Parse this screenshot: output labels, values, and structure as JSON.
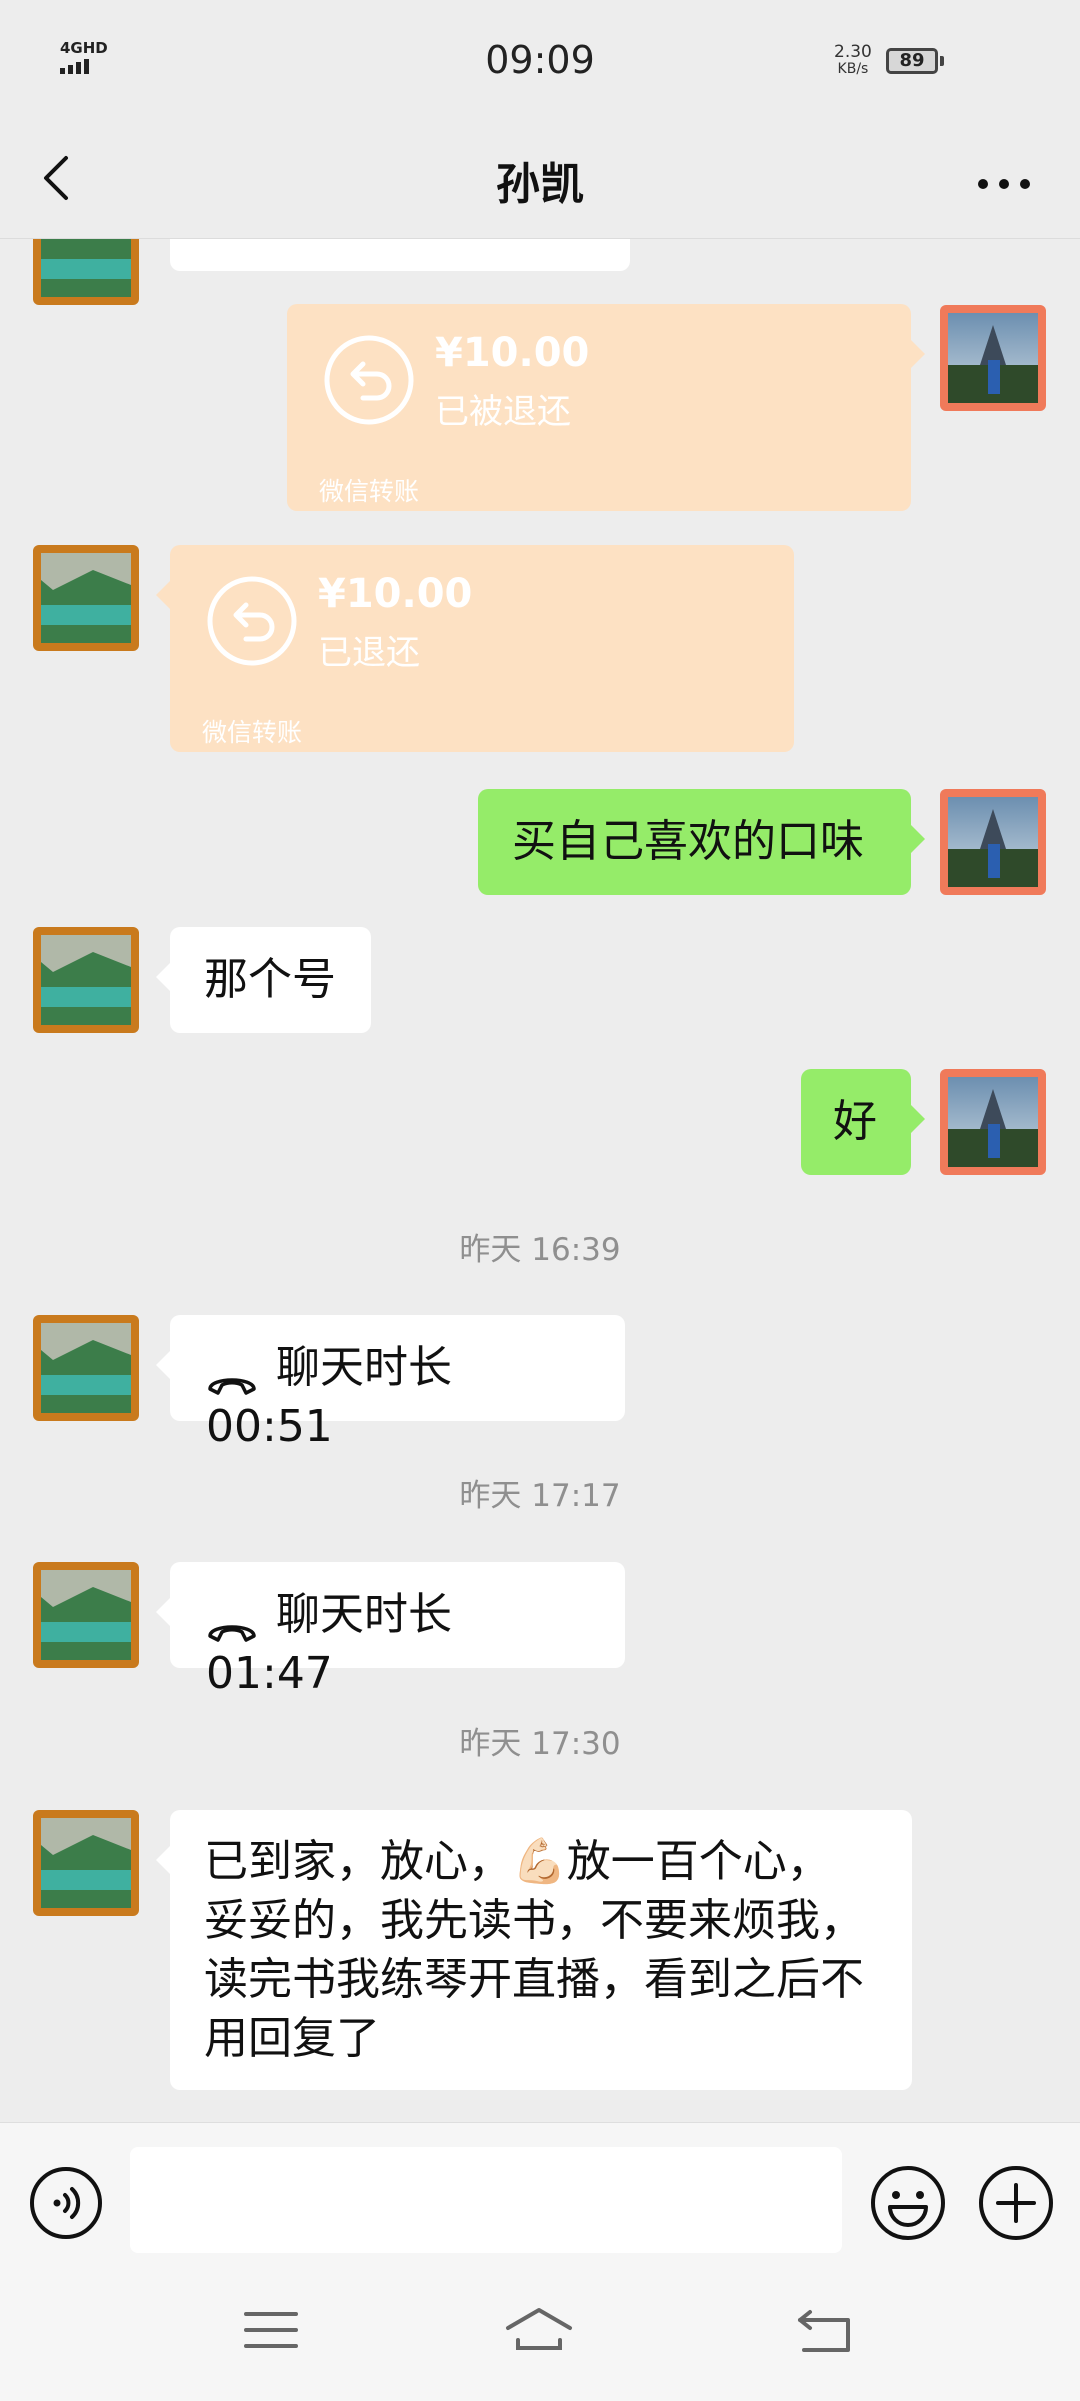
{
  "status_bar": {
    "network": "4GHD",
    "time": "09:09",
    "speed_value": "2.30",
    "speed_unit": "KB/s",
    "battery": "89"
  },
  "header": {
    "title": "孙凯",
    "back_icon": "chevron-left-icon",
    "more_icon": "more-dots-icon"
  },
  "messages": [
    {
      "type": "transfer",
      "side": "right",
      "amount": "¥10.00",
      "status": "已被退还",
      "source": "微信转账"
    },
    {
      "type": "transfer",
      "side": "left",
      "amount": "¥10.00",
      "status": "已退还",
      "source": "微信转账"
    },
    {
      "type": "text",
      "side": "right",
      "text": "买自己喜欢的口味"
    },
    {
      "type": "text",
      "side": "left",
      "text": "那个号"
    },
    {
      "type": "text",
      "side": "right",
      "text": "好"
    },
    {
      "type": "timestamp",
      "text": "昨天 16:39"
    },
    {
      "type": "call",
      "side": "left",
      "text": "聊天时长 00:51"
    },
    {
      "type": "timestamp",
      "text": "昨天 17:17"
    },
    {
      "type": "call",
      "side": "left",
      "text": "聊天时长 01:47"
    },
    {
      "type": "timestamp",
      "text": "昨天 17:30"
    },
    {
      "type": "text",
      "side": "left",
      "lines": [
        "已到家，放心，💪🏻放一百个心，",
        "妥妥的，我先读书，不要来烦我，",
        "读完书我练琴开直播，看到之后不",
        "用回复了"
      ]
    }
  ],
  "input_bar": {
    "placeholder": "",
    "voice_icon": "voice-icon",
    "emoji_icon": "emoji-icon",
    "plus_icon": "plus-icon"
  },
  "system_nav": [
    "menu-icon",
    "home-icon",
    "back-icon"
  ],
  "colors": {
    "background": "#ededed",
    "green_bubble": "#95ec69",
    "white_bubble": "#ffffff",
    "transfer_bubble": "#fde1c3"
  }
}
